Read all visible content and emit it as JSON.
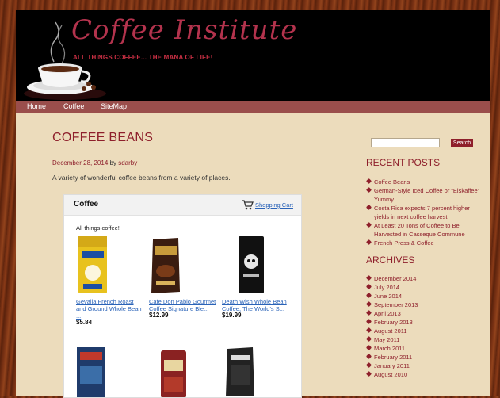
{
  "header": {
    "site_title": "Coffee Institute",
    "tagline": "ALL THINGS COFFEE... THE MANA OF LIFE!"
  },
  "nav": [
    "Home",
    "Coffee",
    "SiteMap"
  ],
  "post": {
    "title": "COFFEE BEANS",
    "date": "December 28, 2014",
    "by": "by",
    "author": "sdarby",
    "excerpt": "A variety of wonderful coffee beans from a variety of places."
  },
  "widget": {
    "title": "Coffee",
    "cart_label": "Shopping Cart",
    "subtitle": "All things coffee!",
    "products": [
      {
        "name": "Gevalia French Roast and Ground Whole Bean ...",
        "price": "$5.84",
        "color": "#e8c21e"
      },
      {
        "name": "Cafe Don Pablo Gourmet Coffee Signature Ble...",
        "price": "$12.99",
        "color": "#3a1c10"
      },
      {
        "name": "Death Wish Whole Bean Coffee, The World's S...",
        "price": "$19.99",
        "color": "#111111"
      }
    ],
    "products_row2": [
      {
        "color": "#1f3b6b"
      },
      {
        "color": "#8a2222"
      },
      {
        "color": "#222222"
      }
    ]
  },
  "sidebar": {
    "search_button": "Search",
    "recent_heading": "RECENT POSTS",
    "recent_posts": [
      "Coffee Beans",
      "German-Style Iced Coffee or “Eiskaffee” Yummy",
      "Costa Rica expects 7 percent higher yields in next coffee harvest",
      "At Least 20 Tons of Coffee to Be Harvested in Casseque Commune",
      "French Press & Coffee"
    ],
    "archives_heading": "ARCHIVES",
    "archives": [
      "December 2014",
      "July 2014",
      "June 2014",
      "September 2013",
      "April 2013",
      "February 2013",
      "August 2011",
      "May 2011",
      "March 2011",
      "February 2011",
      "January 2011",
      "August 2010"
    ]
  },
  "colors": {
    "accent": "#8e1f2b",
    "link": "#2a63b8",
    "nav": "#9a4e4c",
    "page_bg": "#ecdcbc"
  }
}
